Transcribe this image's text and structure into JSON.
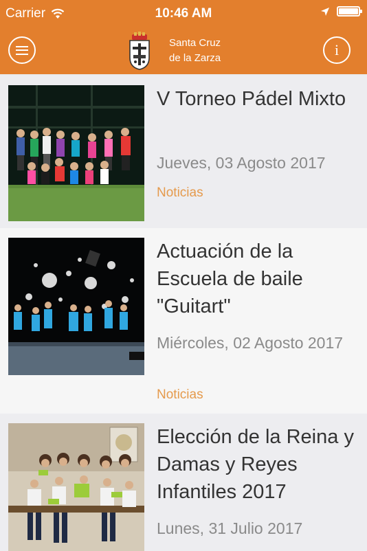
{
  "status": {
    "carrier": "Carrier",
    "time": "10:46 AM"
  },
  "header": {
    "title_line1": "Santa Cruz",
    "title_line2": "de la Zarza",
    "info_glyph": "i"
  },
  "colors": {
    "brand": "#e37f2d",
    "category": "#e59a4c"
  },
  "icons": [
    "wifi-icon",
    "location-arrow-icon",
    "battery-icon",
    "menu-icon",
    "info-icon",
    "coat-of-arms-logo"
  ],
  "news": [
    {
      "title": "V Torneo Pádel Mixto",
      "date": "Jueves, 03 Agosto 2017",
      "category": "Noticias"
    },
    {
      "title": "Actuación de la Escuela de baile \"Guitart\"",
      "date": "Miércoles, 02 Agosto 2017",
      "category": "Noticias"
    },
    {
      "title": "Elección de la Reina y Damas y Reyes Infantiles 2017",
      "date": "Lunes, 31 Julio 2017",
      "category": ""
    }
  ]
}
